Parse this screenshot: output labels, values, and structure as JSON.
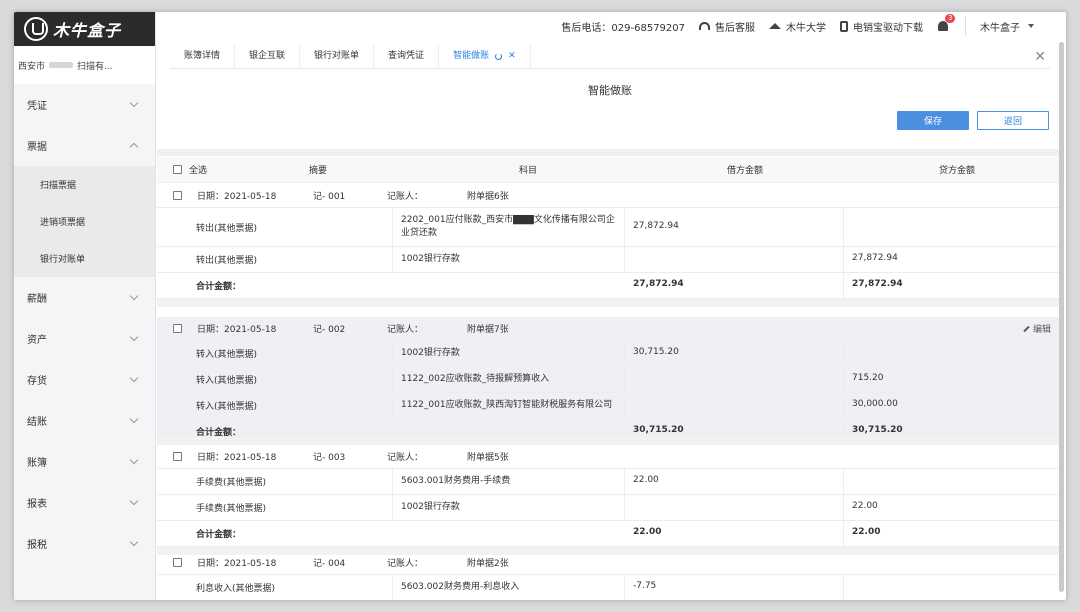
{
  "brand": {
    "name": "木牛盒子"
  },
  "sidebar": {
    "company": "西安市",
    "company_suffix": "扫描有...",
    "items": [
      {
        "label": "凭证",
        "expanded": false
      },
      {
        "label": "票据",
        "expanded": true
      },
      {
        "label": "薪酬",
        "expanded": false
      },
      {
        "label": "资产",
        "expanded": false
      },
      {
        "label": "存货",
        "expanded": false
      },
      {
        "label": "结账",
        "expanded": false
      },
      {
        "label": "账簿",
        "expanded": false
      },
      {
        "label": "报表",
        "expanded": false
      },
      {
        "label": "报税",
        "expanded": false
      }
    ],
    "subitems": [
      "扫描票据",
      "进销项票据",
      "银行对账单"
    ]
  },
  "topbar": {
    "hotline": "售后电话：029-68579207",
    "service": "售后客服",
    "university": "木牛大学",
    "download": "电销宝驱动下载",
    "notify_count": "3",
    "user": "木牛盒子"
  },
  "tabs": [
    "账簿详情",
    "银企互联",
    "银行对账单",
    "查询凭证",
    "智能做账"
  ],
  "page": {
    "title": "智能做账",
    "save": "保存",
    "back": "返回"
  },
  "table_head": {
    "select_all": "全选",
    "summary": "摘要",
    "account": "科目",
    "debit": "借方金额",
    "credit": "贷方金额"
  },
  "labels": {
    "date_prefix": "日期：",
    "recorder": "记账人：",
    "total": "合计金额：",
    "edit": "编辑"
  },
  "vouchers": [
    {
      "date": "2021-05-18",
      "no": "记- 001",
      "attach": "附单据6张",
      "rows": [
        {
          "summary": "转出(其他票据)",
          "account": "2202_001应付账款_西安市▇▇▇文化传播有限公司企业贷还款",
          "debit": "27,872.94",
          "credit": ""
        },
        {
          "summary": "转出(其他票据)",
          "account": "1002银行存款",
          "debit": "",
          "credit": "27,872.94"
        }
      ],
      "total_debit": "27,872.94",
      "total_credit": "27,872.94"
    },
    {
      "date": "2021-05-18",
      "no": "记- 002",
      "attach": "附单据7张",
      "rows": [
        {
          "summary": "转入(其他票据)",
          "account": "1002银行存款",
          "debit": "30,715.20",
          "credit": ""
        },
        {
          "summary": "转入(其他票据)",
          "account": "1122_002应收账款_待报解预算收入",
          "debit": "",
          "credit": "715.20"
        },
        {
          "summary": "转入(其他票据)",
          "account": "1122_001应收账款_陕西淘钉智能财税服务有限公司",
          "debit": "",
          "credit": "30,000.00"
        }
      ],
      "total_debit": "30,715.20",
      "total_credit": "30,715.20"
    },
    {
      "date": "2021-05-18",
      "no": "记- 003",
      "attach": "附单据5张",
      "rows": [
        {
          "summary": "手续费(其他票据)",
          "account": "5603.001财务费用-手续费",
          "debit": "22.00",
          "credit": ""
        },
        {
          "summary": "手续费(其他票据)",
          "account": "1002银行存款",
          "debit": "",
          "credit": "22.00"
        }
      ],
      "total_debit": "22.00",
      "total_credit": "22.00"
    },
    {
      "date": "2021-05-18",
      "no": "记- 004",
      "attach": "附单据2张",
      "rows": [
        {
          "summary": "利息收入(其他票据)",
          "account": "5603.002财务费用-利息收入",
          "debit": "-7.75",
          "credit": ""
        }
      ]
    }
  ]
}
